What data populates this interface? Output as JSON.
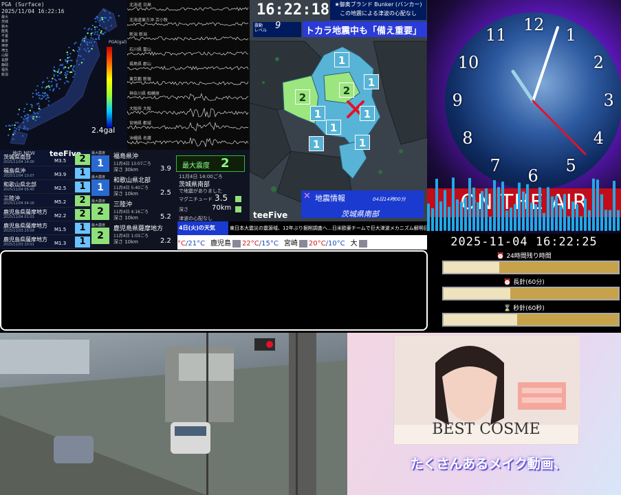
{
  "seismic_map": {
    "header_line1": "PGA (Surface)",
    "header_line2": "2025/11/04 16:22:16",
    "legend": [
      "最大",
      "茨城",
      "栃木",
      "群馬",
      "千葉",
      "東京",
      "神奈",
      "埼玉",
      "山梨",
      "長野",
      "静岡",
      "福島",
      "新潟"
    ],
    "pga_label": "PGA(gal)",
    "gal_value": "2.4gal"
  },
  "waveforms": [
    {
      "label": "北海道 日高"
    },
    {
      "label": "北海道東方沖 苫小牧"
    },
    {
      "label": "新潟 新潟"
    },
    {
      "label": "石川県 富山"
    },
    {
      "label": "福島県 郡山"
    },
    {
      "label": "東京都 新宿"
    },
    {
      "label": "神奈川県 相模原"
    },
    {
      "label": "大阪府 大阪"
    },
    {
      "label": "宮崎県 都城"
    },
    {
      "label": "沖縄県 名護"
    }
  ],
  "quake_list": {
    "header": "地中 NEW",
    "brand": "teeFive",
    "items": [
      {
        "name": "茨城県南部",
        "time": "2025/11/04 14:00",
        "mag": "M3.5",
        "intensity": "2"
      },
      {
        "name": "福島県沖",
        "time": "2025/11/04 13:07",
        "mag": "M3.9",
        "intensity": "1"
      },
      {
        "name": "和歌山県北部",
        "time": "2025/11/04 05:40",
        "mag": "M2.5",
        "intensity": "1"
      },
      {
        "name": "三陸沖",
        "time": "2025/11/04 04:16",
        "mag": "M5.2",
        "intensity": "2"
      },
      {
        "name": "鹿児島県薩摩地方",
        "time": "2025/11/04 01:03",
        "mag": "M2.2",
        "intensity": "2"
      },
      {
        "name": "鹿児島県薩摩地方",
        "time": "2025/11/03 20:09",
        "mag": "M1.5",
        "intensity": "1"
      },
      {
        "name": "鹿児島県薩摩地方",
        "time": "2025/11/03 20:01",
        "mag": "M1.3",
        "intensity": "1"
      }
    ]
  },
  "quake_detail": {
    "items": [
      {
        "label": "最大震度",
        "name": "福島県沖",
        "date": "11月4日 13:07ごろ",
        "depth": "深さ 30km",
        "mag": "3.9",
        "intensity": "1"
      },
      {
        "label": "最大震度",
        "name": "和歌山県北部",
        "date": "11月4日 5:40ごろ",
        "depth": "深さ 10km",
        "mag": "2.5",
        "intensity": "1"
      },
      {
        "label": "最大震度",
        "name": "三陸沖",
        "date": "11月4日 4:16ごろ",
        "depth": "深さ 10km",
        "mag": "5.2",
        "intensity": "2"
      },
      {
        "label": "最大震度",
        "name": "鹿児島県薩摩地方",
        "date": "11月4日 1:03ごろ",
        "depth": "深さ 10km",
        "mag": "2.2",
        "intensity": "2"
      }
    ],
    "max_label": "最大震度",
    "max_value": "2",
    "latest": {
      "date": "11月4日 14:00ごろ",
      "region": "茨城県南部",
      "place": "で地震がありました",
      "magnitude_label": "マグニチュード",
      "magnitude": "3.5",
      "depth_label": "深さ",
      "depth": "70km",
      "tsunami": "津波の心配なし"
    }
  },
  "center_map": {
    "clock": "16:22:18",
    "bunker_line1": "★御奥ブランド Bunker (バンカー)",
    "bunker_line2": "この地震による津波の心配なし",
    "shindo_label": "震動\nレベル",
    "shindo_value": "9",
    "headline": "トカラ地震中も「備え重要」",
    "info_title": "地震情報",
    "info_time": "04日14時00分",
    "info_region": "茨城県南部",
    "brand": "teeFive",
    "areas": [
      {
        "value": "1"
      },
      {
        "value": "1"
      },
      {
        "value": "2"
      },
      {
        "value": "2"
      },
      {
        "value": "1"
      },
      {
        "value": "1"
      },
      {
        "value": "1"
      },
      {
        "value": "1"
      },
      {
        "value": "1"
      }
    ]
  },
  "ticker": {
    "weather_tag": "4日(火)の天気",
    "news": "東日本大震災の震源域、12年ぶり掘削調査へ…日米欧豪チームで巨大津波メカニズム解明目指す",
    "weather": [
      {
        "city": "",
        "hi": "°C",
        "lo": "/21°C"
      },
      {
        "city": "鹿児島",
        "hi": "22°C",
        "lo": "/15°C"
      },
      {
        "city": "宮崎",
        "hi": "20°C",
        "lo": "/10°C"
      },
      {
        "city": "大",
        "hi": "",
        "lo": ""
      }
    ]
  },
  "clock_panel": {
    "numbers": [
      "12",
      "1",
      "2",
      "3",
      "4",
      "5",
      "6",
      "7",
      "8",
      "9",
      "10",
      "11"
    ],
    "on_air": "ON THE AIR",
    "datetime": "2025-11-04 16:22:25"
  },
  "progress": [
    {
      "icon": "⏰",
      "label": "24時間残り時間",
      "value": 0.32
    },
    {
      "icon": "⏰",
      "label": "長針(60分)",
      "value": 0.38
    },
    {
      "icon": "⌛",
      "label": "秒針(60秒)",
      "value": 0.42
    }
  ],
  "ad": {
    "title": "BEST COSME",
    "caption": "たくさんあるメイク動画、"
  },
  "colors": {
    "intensity1": "#2a6ad0",
    "intensity2": "#8fe07a",
    "on_air": "#c10d1a",
    "progress_track": "#c6a24a"
  }
}
